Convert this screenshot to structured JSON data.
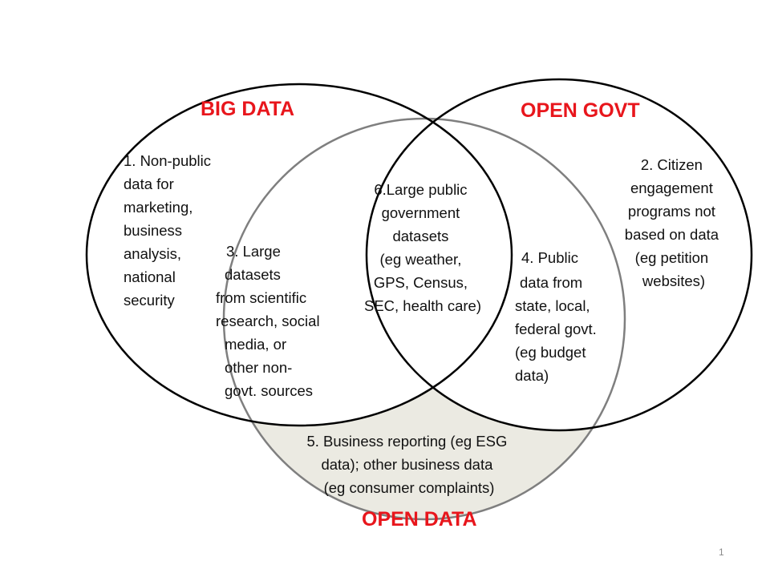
{
  "diagram": {
    "type": "venn",
    "colors": {
      "title_red": "#e8161c",
      "big_data_stroke": "#000000",
      "open_govt_stroke": "#000000",
      "open_data_stroke": "#7f7f7f",
      "open_data_fill": "#ebeae2"
    },
    "circles": {
      "big_data": {
        "title": "BIG DATA"
      },
      "open_govt": {
        "title": "OPEN GOVT"
      },
      "open_data": {
        "title": "OPEN DATA"
      }
    },
    "regions": {
      "r1": [
        "1. Non-public",
        "data for",
        "marketing,",
        "business",
        "analysis,",
        "national",
        "security"
      ],
      "r2": [
        "2. Citizen",
        "engagement",
        "programs not",
        "based on data",
        "(eg petition",
        "websites)"
      ],
      "r3": [
        "3. Large",
        "datasets",
        "from scientific",
        "research, social",
        "media, or",
        "other non-",
        "govt. sources"
      ],
      "r4": [
        "4. Public",
        "data from",
        "state, local,",
        "federal  govt.",
        "(eg budget",
        "data)"
      ],
      "r5": [
        "5. Business reporting (eg ESG",
        "data); other business data",
        "(eg consumer complaints)"
      ],
      "r6": [
        "6.Large public",
        "government",
        "datasets",
        "(eg weather,",
        "GPS, Census,",
        "SEC, health care)"
      ]
    }
  },
  "page_number": "1"
}
